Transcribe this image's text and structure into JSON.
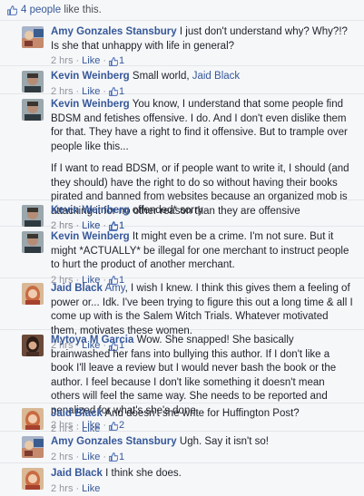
{
  "likes_bar": {
    "count_text": "4 people",
    "suffix": " like this."
  },
  "comments": [
    {
      "author": "Amy Gonzales Stansbury",
      "avatar": "amy",
      "paragraphs": [
        {
          "text": "I just don't understand why? Why?!? Is she that unhappy with life in general?"
        }
      ],
      "time": "2 hrs",
      "like_label": "Like",
      "like_count": "1"
    },
    {
      "author": "Kevin Weinberg",
      "avatar": "kevin",
      "paragraphs": [
        {
          "text": "Small world, ",
          "mention": "Jaid Black"
        }
      ],
      "time": "2 hrs",
      "like_label": "Like",
      "like_count": "1"
    },
    {
      "author": "Kevin Weinberg",
      "avatar": "kevin",
      "paragraphs": [
        {
          "text": "You know, I understand that some people find BDSM and fetishes offensive. I do. And I don't even dislike them for that. They have a right to find it offensive. But to trample over people like this..."
        },
        {
          "text": "If I want to read BDSM, or if people want to write it, I should (and they should) have the right to do so without having their books pirated and banned from websites because an organized mob is attacking it for no other reason than they are offensive"
        }
      ],
      "time": "2 hrs",
      "like_label": "Like",
      "like_count": "1"
    },
    {
      "author": "Kevin Weinberg",
      "avatar": "kevin",
      "paragraphs": [
        {
          "text": "offended* sorry"
        }
      ],
      "time": "2 hrs",
      "like_label": "Like",
      "like_count": "1"
    },
    {
      "author": "Kevin Weinberg",
      "avatar": "kevin",
      "paragraphs": [
        {
          "text": "It might even be a crime. I'm not sure. But it might *ACTUALLY* be illegal for one merchant to instruct people to hurt the product of another merchant."
        }
      ],
      "time": "2 hrs",
      "like_label": "Like",
      "like_count": "1"
    },
    {
      "author": "Jaid Black",
      "avatar": "jaid",
      "paragraphs": [
        {
          "mention": "Amy",
          "text": ", I wish I knew. I think this gives them a feeling of power or... Idk. I've been trying to figure this out a long time & all I come up with is the Salem Witch Trials. Whatever motivated them, motivates these women."
        }
      ],
      "time": "2 hrs",
      "like_label": "Like",
      "like_count": "1"
    },
    {
      "author": "Mytoya M Garcia",
      "avatar": "mytoya",
      "paragraphs": [
        {
          "text": "Wow. She snapped! She basically brainwashed her fans into bullying this author. If I don't like a book I'll leave a review but I would never bash the book or the author. I feel because I don't like something it doesn't mean others will feel the same way. She needs to be reported and penalized for what's she's done."
        }
      ],
      "time": "2 hrs",
      "like_label": "Like",
      "like_count": "2"
    },
    {
      "author": "Jaid Black",
      "avatar": "jaid",
      "paragraphs": [
        {
          "text": "And doesn't she write for Huffington Post?"
        }
      ],
      "time": "2 hrs",
      "like_label": "Like",
      "like_count": ""
    },
    {
      "author": "Amy Gonzales Stansbury",
      "avatar": "amy",
      "paragraphs": [
        {
          "text": "Ugh. Say it isn't so!"
        }
      ],
      "time": "2 hrs",
      "like_label": "Like",
      "like_count": "1"
    },
    {
      "author": "Jaid Black",
      "avatar": "jaid",
      "paragraphs": [
        {
          "text": "I think she does."
        }
      ],
      "time": "2 hrs",
      "like_label": "Like",
      "like_count": ""
    }
  ]
}
